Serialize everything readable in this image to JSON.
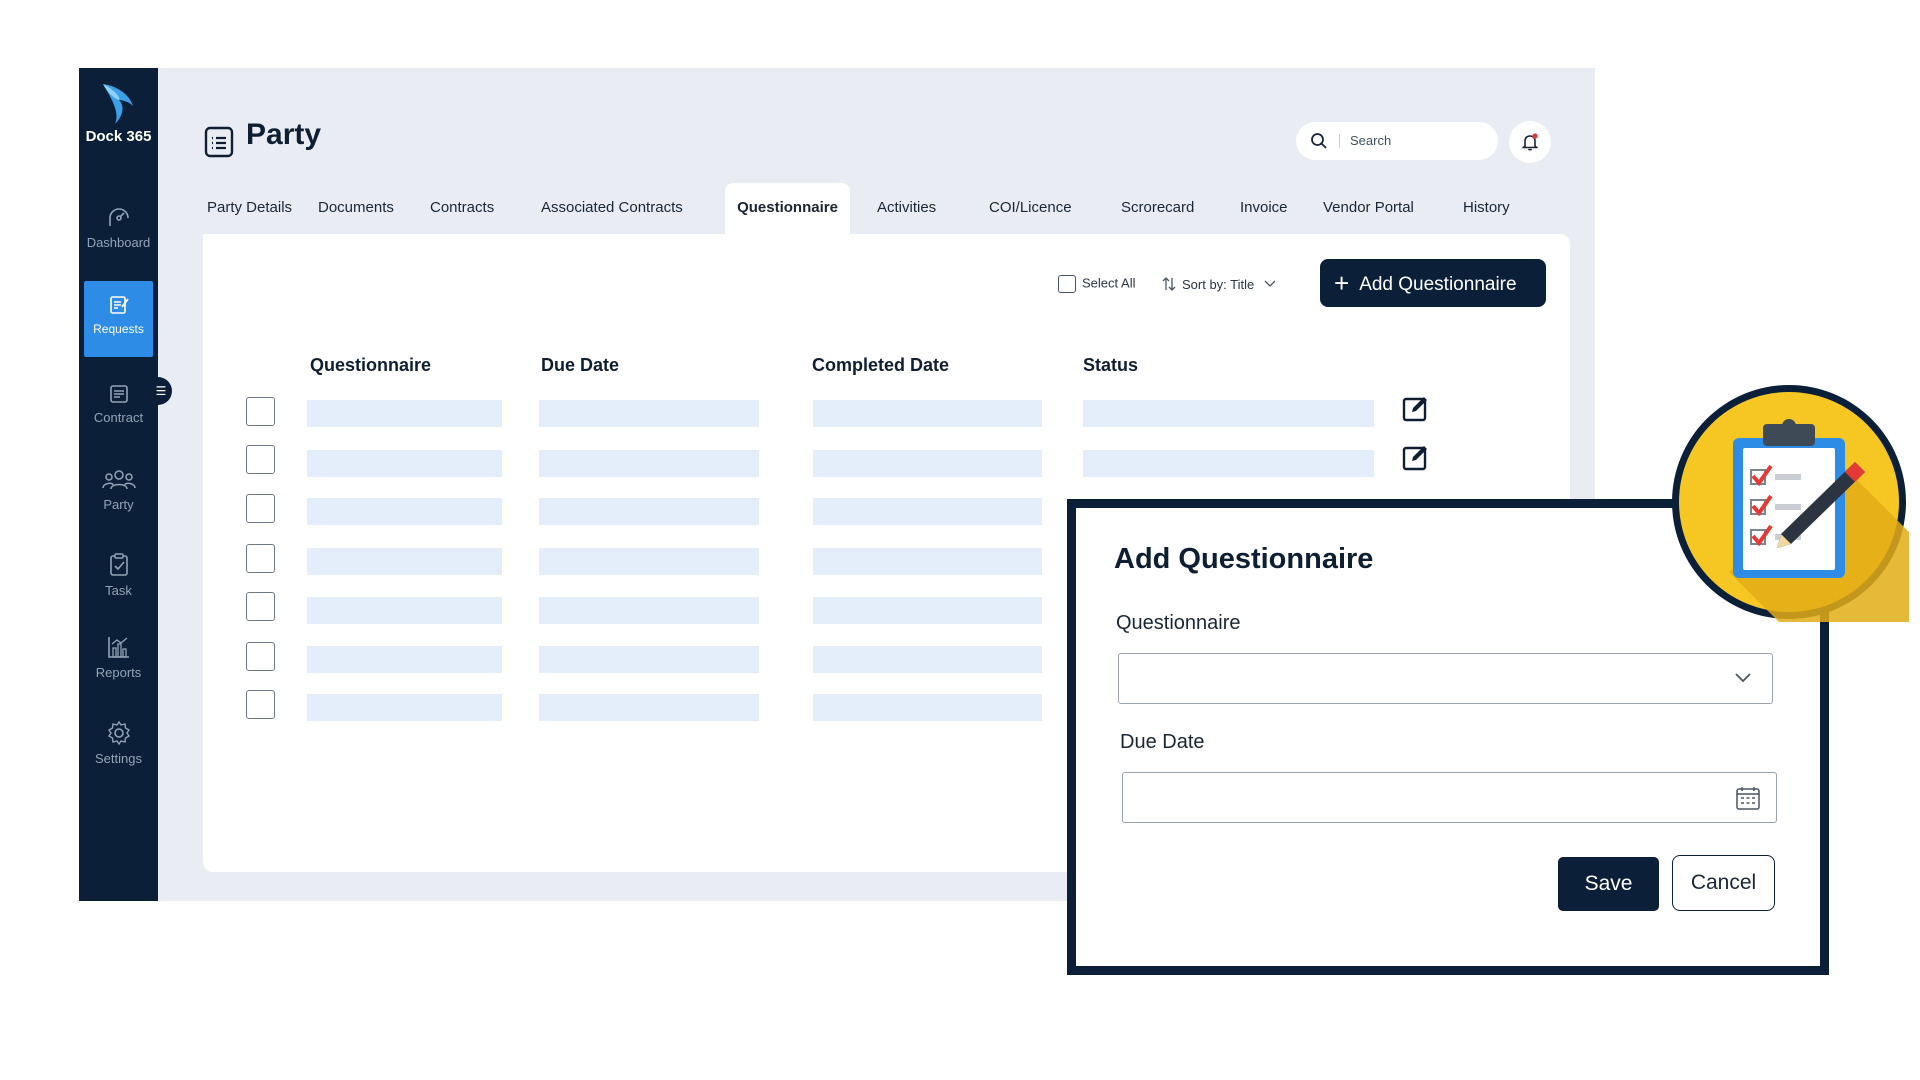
{
  "app": {
    "logo_text": "Dock 365"
  },
  "sidebar": {
    "items": [
      {
        "label": "Dashboard",
        "icon": "dashboard-icon"
      },
      {
        "label": "Requests",
        "icon": "requests-icon",
        "active": true
      },
      {
        "label": "Contract",
        "icon": "contract-icon"
      },
      {
        "label": "Party",
        "icon": "party-icon"
      },
      {
        "label": "Task",
        "icon": "task-icon"
      },
      {
        "label": "Reports",
        "icon": "reports-icon"
      },
      {
        "label": "Settings",
        "icon": "settings-icon"
      }
    ]
  },
  "header": {
    "title": "Party",
    "search_placeholder": "Search"
  },
  "tabs": [
    {
      "label": "Party Details"
    },
    {
      "label": "Documents"
    },
    {
      "label": "Contracts"
    },
    {
      "label": "Associated Contracts"
    },
    {
      "label": "Questionnaire",
      "active": true
    },
    {
      "label": "Activities"
    },
    {
      "label": "COI/Licence"
    },
    {
      "label": "Scrorecard"
    },
    {
      "label": "Invoice"
    },
    {
      "label": "Vendor Portal"
    },
    {
      "label": "History"
    }
  ],
  "toolbar": {
    "select_all": "Select All",
    "sort_label": "Sort by: Title",
    "add_button": "Add Questionnaire"
  },
  "table": {
    "columns": [
      "Questionnaire",
      "Due Date",
      "Completed Date",
      "Status"
    ],
    "row_count": 7
  },
  "dialog": {
    "title": "Add Questionnaire",
    "field1_label": "Questionnaire",
    "field1_value": "",
    "field2_label": "Due Date",
    "field2_value": "",
    "save": "Save",
    "cancel": "Cancel"
  },
  "colors": {
    "navy": "#0b2038",
    "accent": "#2d8ce6",
    "badge_yellow": "#f6c623",
    "placeholder_bar": "#e4eefb"
  }
}
